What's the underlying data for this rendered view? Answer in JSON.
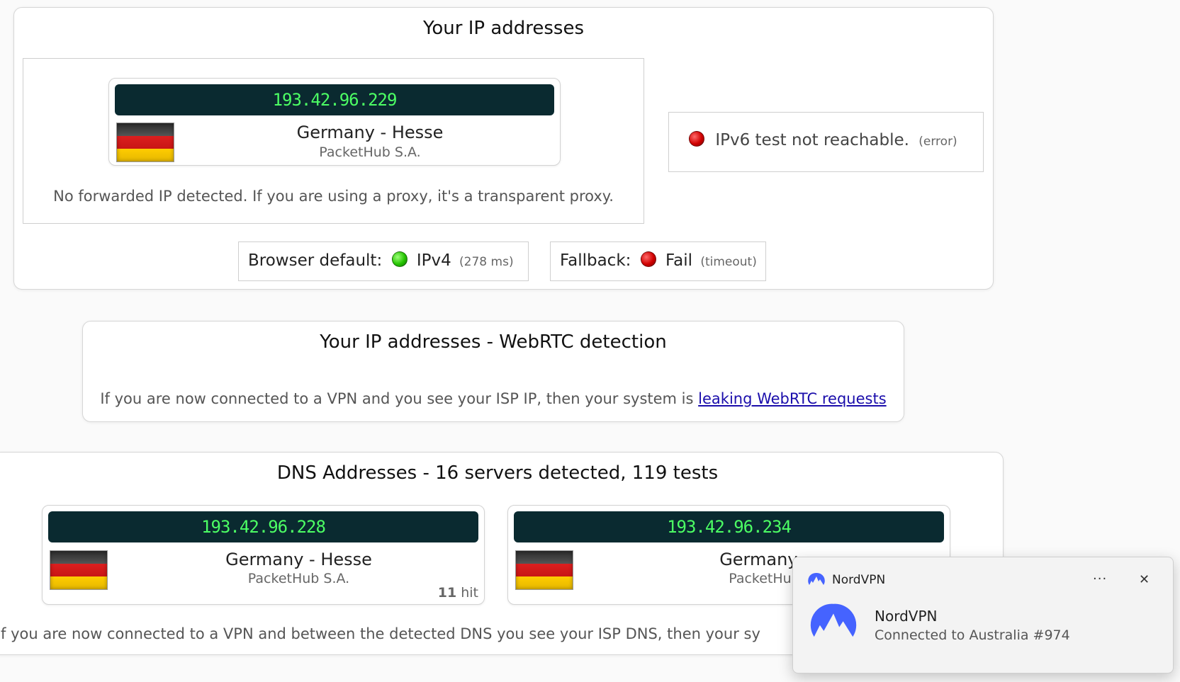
{
  "ip_section": {
    "title": "Your IP addresses",
    "public_ip": {
      "ip": "193.42.96.229",
      "location": "Germany - Hesse",
      "isp": "PacketHub S.A.",
      "flag_icon": "germany-flag-icon"
    },
    "forwarded_text": "No forwarded IP detected. If you are using a proxy, it's a transparent proxy.",
    "ipv6": {
      "text": "IPv6 test not reachable.",
      "note": "(error)",
      "status_color": "#d00000"
    },
    "browser_default": {
      "label": "Browser default:",
      "value": "IPv4",
      "note": "(278 ms)",
      "status_color": "#25c400"
    },
    "fallback": {
      "label": "Fallback:",
      "value": "Fail",
      "note": "(timeout)",
      "status_color": "#d00000"
    }
  },
  "webrtc_section": {
    "title": "Your IP addresses - WebRTC detection",
    "text": "If you are now connected to a VPN and you see your ISP IP, then your system is",
    "link": "leaking WebRTC requests"
  },
  "dns_section": {
    "title": "DNS Addresses - 16 servers detected, 119 tests",
    "servers": [
      {
        "ip": "193.42.96.228",
        "location": "Germany - Hesse",
        "isp": "PacketHub S.A.",
        "hits": "11",
        "hit_label": "hit"
      },
      {
        "ip": "193.42.96.234",
        "location": "Germany -",
        "isp": "PacketHub"
      }
    ],
    "footer_text": "f you are now connected to a VPN and between the detected DNS you see your ISP DNS, then your sy"
  },
  "notification": {
    "app_name": "NordVPN",
    "more_label": "···",
    "close_label": "✕",
    "title": "NordVPN",
    "message": "Connected to Australia #974",
    "brand_color": "#4563ff"
  }
}
